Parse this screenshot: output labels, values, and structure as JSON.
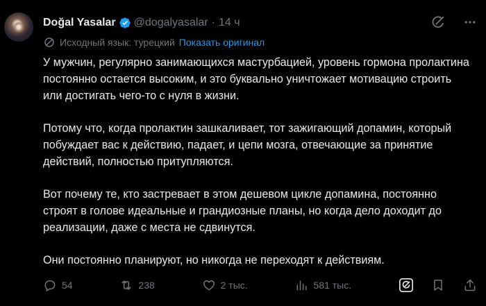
{
  "author": {
    "name": "Doğal Yasalar",
    "handle": "@dogalyasalar",
    "separator": "·",
    "time": "14 ч"
  },
  "translation": {
    "label": "Исходный язык: турецкий",
    "show_original": "Показать оригинал"
  },
  "tweet": {
    "paragraphs": [
      "У мужчин, регулярно занимающихся мастурбацией, уровень гормона пролактина постоянно остается высоким, и это буквально уничтожает мотивацию строить или достигать чего-то с нуля в жизни.",
      "Потому что, когда пролактин зашкаливает, тот зажигающий допамин, который побуждает вас к действию, падает, и цепи мозга, отвечающие за принятие действий, полностью притупляются.",
      "Вот почему те, кто застревает в этом дешевом цикле допамина, постоянно строят в голове идеальные и грандиозные планы, но когда дело доходит до реализации, даже с места не сдвинутся.",
      "Они постоянно планируют, но никогда не переходят к действиям."
    ]
  },
  "metrics": {
    "replies": "54",
    "reposts": "238",
    "likes": "2 тыс.",
    "views": "581 тыс."
  },
  "icons": {
    "verified": "verified-badge-icon",
    "grok": "grok-icon",
    "more": "more-icon",
    "translate": "translate-icon",
    "reply": "reply-icon",
    "repost": "repost-icon",
    "like": "like-icon",
    "views": "views-icon",
    "bookmark": "bookmark-icon",
    "share": "share-icon"
  },
  "colors": {
    "background": "#000000",
    "text": "#e7e9ea",
    "muted": "#71767b",
    "accent": "#1d9bf0"
  }
}
